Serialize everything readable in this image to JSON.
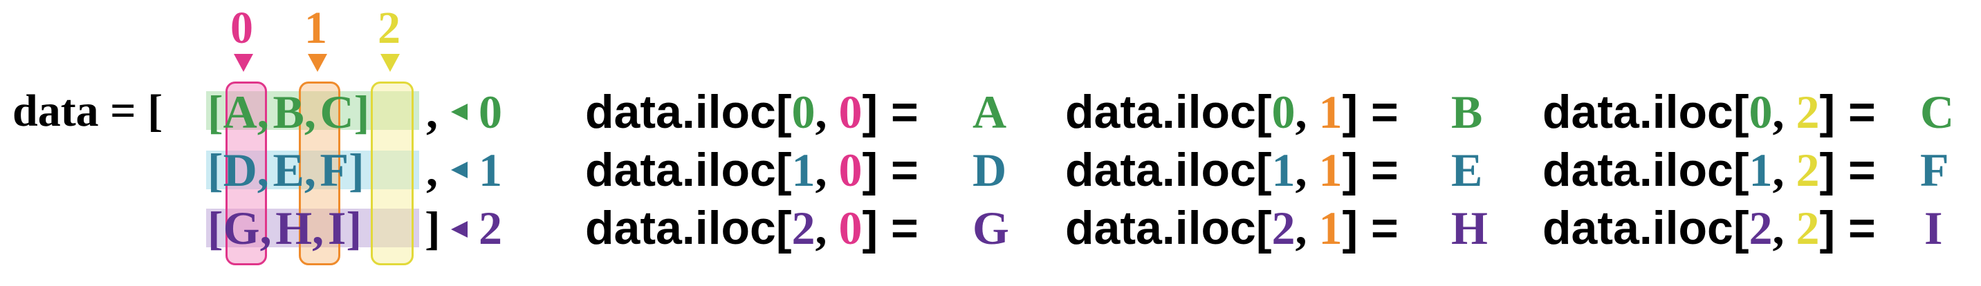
{
  "colors": {
    "row0": "#3f9a4b",
    "row1": "#2d7a94",
    "row2": "#5e3291",
    "col0": "#e0368a",
    "col1": "#ef8b2c",
    "col2": "#e2d93a",
    "text": "#000000"
  },
  "diagram": {
    "prefix": "data = [",
    "close_bracket": "]",
    "row_separator": ",",
    "rows": [
      {
        "cells": [
          "A",
          "B",
          "C"
        ],
        "index": "0"
      },
      {
        "cells": [
          "D",
          "E",
          "F"
        ],
        "index": "1"
      },
      {
        "cells": [
          "G",
          "H",
          "I"
        ],
        "index": "2"
      }
    ],
    "column_indices": [
      "0",
      "1",
      "2"
    ]
  },
  "lookups": {
    "prefix": "data.iloc[",
    "suffix": "] =",
    "columns": [
      {
        "col": "0",
        "entries": [
          {
            "row": "0",
            "result": "A"
          },
          {
            "row": "1",
            "result": "D"
          },
          {
            "row": "2",
            "result": "G"
          }
        ]
      },
      {
        "col": "1",
        "entries": [
          {
            "row": "0",
            "result": "B"
          },
          {
            "row": "1",
            "result": "E"
          },
          {
            "row": "2",
            "result": "H"
          }
        ]
      },
      {
        "col": "2",
        "entries": [
          {
            "row": "0",
            "result": "C"
          },
          {
            "row": "1",
            "result": "F"
          },
          {
            "row": "2",
            "result": "I"
          }
        ]
      }
    ]
  }
}
